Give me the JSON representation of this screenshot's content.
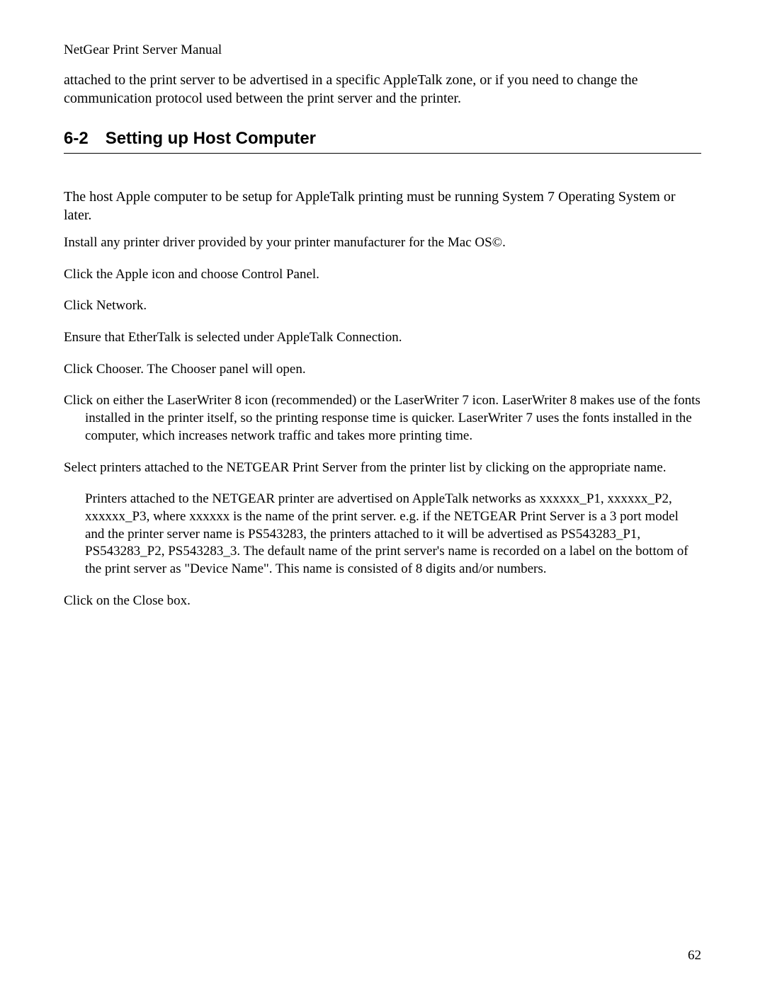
{
  "header": {
    "title": "NetGear Print Server Manual"
  },
  "intro": {
    "text": "attached to the print server to be advertised in a specific AppleTalk zone, or if you need to change the communication protocol used between the print server and the printer."
  },
  "section": {
    "number": "6-2",
    "title": "Setting up Host Computer"
  },
  "body": {
    "para1": "The host Apple computer to be setup for AppleTalk printing must be running System 7 Operating System or later.",
    "step1": "Install any printer driver provided by your printer manufacturer for the Mac OS©.",
    "step2": "Click the Apple icon and choose Control Panel.",
    "step3": "Click Network.",
    "step4": "Ensure that EtherTalk is selected under AppleTalk Connection.",
    "step5": "Click Chooser. The Chooser panel will open.",
    "step6": "Click on either the LaserWriter 8 icon (recommended) or the LaserWriter 7 icon. LaserWriter 8 makes use of the fonts installed in the printer itself, so the printing response time is quicker. LaserWriter 7 uses the fonts installed in the computer, which increases network traffic and takes more printing time.",
    "step7": "Select printers attached to the NETGEAR Print Server from the printer list by clicking on the appropriate name.",
    "step7_sub": "Printers attached to the NETGEAR printer are advertised on AppleTalk networks as xxxxxx_P1, xxxxxx_P2, xxxxxx_P3, where xxxxxx is the name of the print server. e.g. if the NETGEAR Print Server is a 3 port model and the printer server name is PS543283, the printers attached to it will be advertised as PS543283_P1, PS543283_P2, PS543283_3. The default name of the print server's name is recorded on a label on the bottom of the print server as \"Device Name\". This name is consisted of 8 digits and/or numbers.",
    "step8": "Click on the Close box."
  },
  "page_number": "62"
}
